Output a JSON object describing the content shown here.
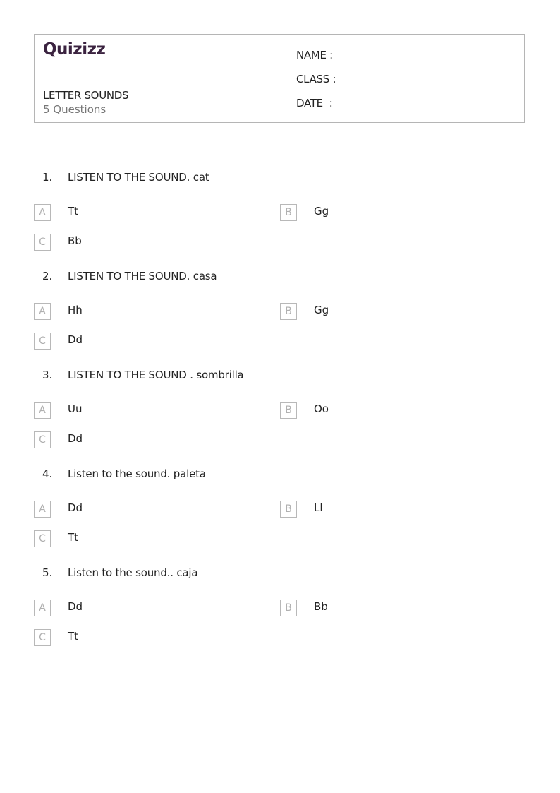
{
  "header": {
    "logo": "Quizizz",
    "title": "LETTER SOUNDS",
    "subtitle": "5 Questions",
    "fields": [
      {
        "label": "NAME :"
      },
      {
        "label": "CLASS :"
      },
      {
        "label": "DATE  :"
      }
    ]
  },
  "questions": [
    {
      "number": "1.",
      "text": "LISTEN TO THE SOUND. cat",
      "options": [
        {
          "letter": "A",
          "text": "Tt"
        },
        {
          "letter": "B",
          "text": "Gg"
        },
        {
          "letter": "C",
          "text": "Bb"
        }
      ]
    },
    {
      "number": "2.",
      "text": "LISTEN TO THE SOUND. casa",
      "options": [
        {
          "letter": "A",
          "text": "Hh"
        },
        {
          "letter": "B",
          "text": "Gg"
        },
        {
          "letter": "C",
          "text": "Dd"
        }
      ]
    },
    {
      "number": "3.",
      "text": "LISTEN TO THE SOUND . sombrilla",
      "options": [
        {
          "letter": "A",
          "text": "Uu"
        },
        {
          "letter": "B",
          "text": "Oo"
        },
        {
          "letter": "C",
          "text": "Dd"
        }
      ]
    },
    {
      "number": "4.",
      "text": "Listen to the sound. paleta",
      "options": [
        {
          "letter": "A",
          "text": "Dd"
        },
        {
          "letter": "B",
          "text": "Ll"
        },
        {
          "letter": "C",
          "text": "Tt"
        }
      ]
    },
    {
      "number": "5.",
      "text": "Listen to the sound.. caja",
      "options": [
        {
          "letter": "A",
          "text": "Dd"
        },
        {
          "letter": "B",
          "text": "Bb"
        },
        {
          "letter": "C",
          "text": "Tt"
        }
      ]
    }
  ]
}
